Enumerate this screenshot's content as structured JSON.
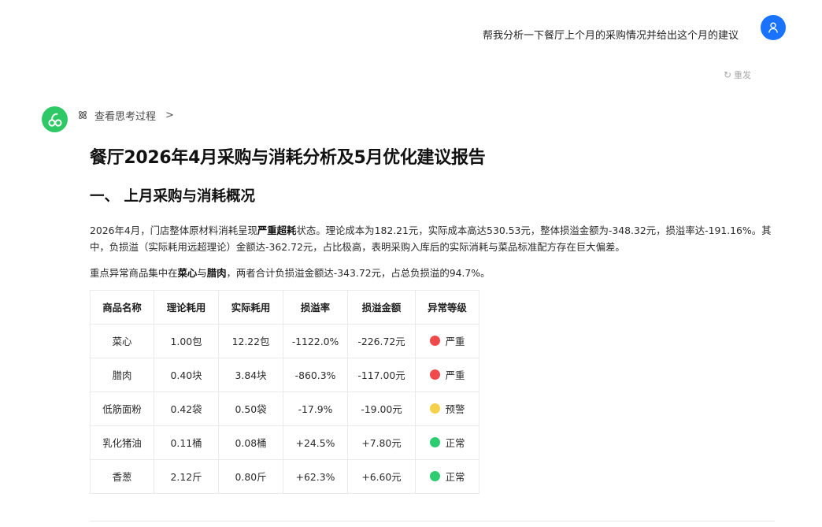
{
  "user": {
    "message": "帮我分析一下餐厅上个月的采购情况并给出这个月的建议",
    "resend_label": "重发",
    "avatar_icon": "user-icon",
    "avatar_color": "#1a73ff"
  },
  "bot": {
    "avatar_icon": "brand-logo-icon",
    "avatar_color": "#2ec866",
    "thinking_label": "查看思考过程"
  },
  "report": {
    "title": "餐厅2026年4月采购与消耗分析及5月优化建议报告",
    "section1_title": "一、 上月采购与消耗概况",
    "para1": {
      "a": "2026年4月，门店整体原材料消耗呈现",
      "b_bold": "严重超耗",
      "c": "状态。理论成本为182.21元，实际成本高达530.53元，整体损溢金额为-348.32元，损溢率达-191.16%。其中，负损溢（实际耗用远超理论）金额达-362.72元，占比极高，表明采购入库后的实际消耗与菜品标准配方存在巨大偏差。"
    },
    "para2": {
      "a": "重点异常商品集中在",
      "b_bold": "菜心",
      "c": "与",
      "d_bold": "腊肉",
      "e": "，两者合计负损溢金额达-343.72元，占总负损溢的94.7%。"
    },
    "table": {
      "headers": [
        "商品名称",
        "理论耗用",
        "实际耗用",
        "损溢率",
        "损溢金额",
        "异常等级"
      ],
      "rows": [
        {
          "name": "菜心",
          "theory": "1.00包",
          "actual": "12.22包",
          "rate": "-1122.0%",
          "amount": "-226.72元",
          "level": "严重",
          "level_color": "#f04a4a"
        },
        {
          "name": "腊肉",
          "theory": "0.40块",
          "actual": "3.84块",
          "rate": "-860.3%",
          "amount": "-117.00元",
          "level": "严重",
          "level_color": "#f04a4a"
        },
        {
          "name": "低筋面粉",
          "theory": "0.42袋",
          "actual": "0.50袋",
          "rate": "-17.9%",
          "amount": "-19.00元",
          "level": "预警",
          "level_color": "#f5d04a"
        },
        {
          "name": "乳化猪油",
          "theory": "0.11桶",
          "actual": "0.08桶",
          "rate": "+24.5%",
          "amount": "+7.80元",
          "level": "正常",
          "level_color": "#2ecc71"
        },
        {
          "name": "香葱",
          "theory": "2.12斤",
          "actual": "0.80斤",
          "rate": "+62.3%",
          "amount": "+6.60元",
          "level": "正常",
          "level_color": "#2ecc71"
        }
      ]
    }
  }
}
